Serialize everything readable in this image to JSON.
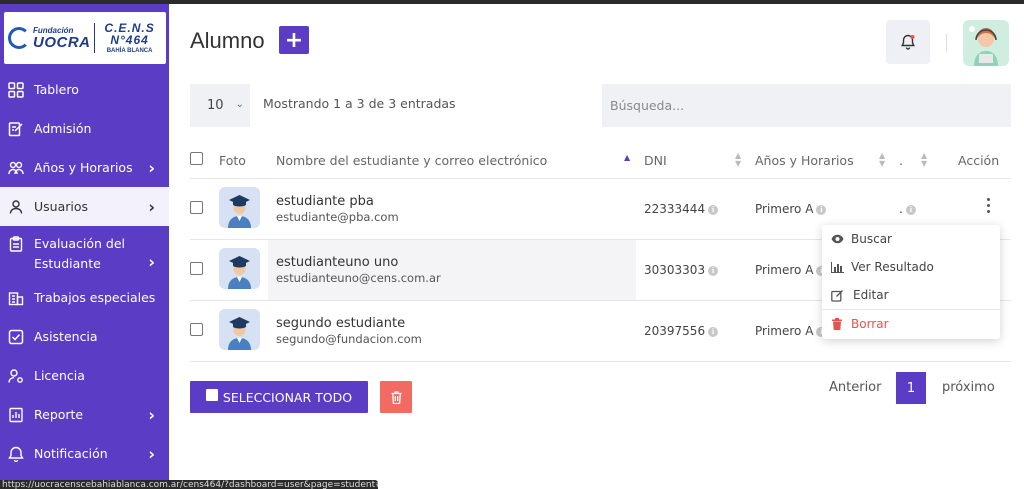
{
  "sidebar": {
    "logo": {
      "fundacion": "Fundación",
      "uocra": "UOCRA",
      "cens": "C.E.N.S N°464",
      "city": "BAHÍA BLANCA"
    },
    "items": [
      {
        "label": "Tablero",
        "icon": "dashboard-icon"
      },
      {
        "label": "Admisión",
        "icon": "edit-document-icon"
      },
      {
        "label": "Años y Horarios",
        "icon": "users-icon",
        "has_submenu": true
      },
      {
        "label": "Usuarios",
        "icon": "user-icon",
        "has_submenu": true,
        "active": true
      },
      {
        "label": "Evaluación del Estudiante",
        "icon": "clipboard-icon",
        "has_submenu": true
      },
      {
        "label": "Trabajos especiales",
        "icon": "building-icon"
      },
      {
        "label": "Asistencia",
        "icon": "check-square-icon"
      },
      {
        "label": "Licencia",
        "icon": "user-settings-icon"
      },
      {
        "label": "Reporte",
        "icon": "report-icon",
        "has_submenu": true
      },
      {
        "label": "Notificación",
        "icon": "notification-icon",
        "has_submenu": true
      }
    ]
  },
  "header": {
    "title": "Alumno",
    "add_label": "+"
  },
  "controls": {
    "per_page": "10",
    "showing": "Mostrando 1 a 3 de 3 entradas",
    "search_placeholder": "Búsqueda..."
  },
  "table": {
    "columns": {
      "photo": "Foto",
      "name": "Nombre del estudiante y correo electrónico",
      "dni": "DNI",
      "year": "Años y Horarios",
      "dot": ".",
      "action": "Acción"
    },
    "rows": [
      {
        "name": "estudiante pba",
        "email": "estudiante@pba.com",
        "dni": "22333444",
        "year": "Primero A",
        "dot": "."
      },
      {
        "name": "estudianteuno uno",
        "email": "estudianteuno@cens.com.ar",
        "dni": "30303303",
        "year": "Primero A",
        "dot": ""
      },
      {
        "name": "segundo estudiante",
        "email": "segundo@fundacion.com",
        "dni": "20397556",
        "year": "Primero A",
        "dot": ""
      }
    ]
  },
  "action_menu": {
    "items": [
      {
        "label": "Buscar",
        "icon": "eye-icon"
      },
      {
        "label": "Ver Resultado",
        "icon": "bar-chart-icon"
      },
      {
        "label": "Editar",
        "icon": "edit-icon"
      },
      {
        "label": "Borrar",
        "icon": "trash-icon"
      }
    ]
  },
  "footer": {
    "select_all": "SELECCIONAR TODO",
    "prev": "Anterior",
    "page": "1",
    "next": "próximo"
  },
  "statusbar": {
    "url": "https://uocracenscebahiablanca.com.ar/cens464/?dashboard=user&page=student#"
  },
  "colors": {
    "primary": "#5b3cc4",
    "danger": "#f26b62",
    "muted_bg": "#f0f1f5"
  }
}
